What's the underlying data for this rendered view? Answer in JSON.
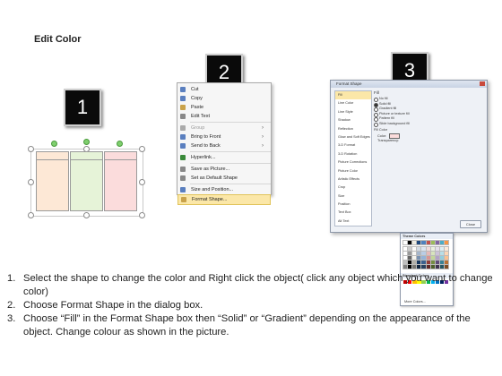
{
  "title": "Edit Color",
  "step_numbers": [
    "1",
    "2",
    "3"
  ],
  "shapes": {
    "card_colors": [
      "#fde8d6",
      "#e6f3d8",
      "#fbdcdc"
    ],
    "tab_colors": [
      "#fde8d6",
      "#e6f3d8",
      "#fbdcdc"
    ]
  },
  "context_menu": {
    "items": [
      {
        "label": "Cut",
        "icon": "scissors-icon",
        "icon_color": "#5a7fbf"
      },
      {
        "label": "Copy",
        "icon": "copy-icon",
        "icon_color": "#5a7fbf"
      },
      {
        "label": "Paste",
        "icon": "paste-icon",
        "icon_color": "#c9a24a"
      },
      {
        "label": "Edit Text",
        "icon": "text-icon",
        "icon_color": "#888888"
      },
      {
        "label": "Group",
        "icon": "group-icon",
        "icon_color": "#aaaaaa",
        "submenu": true,
        "disabled": true
      },
      {
        "label": "Bring to Front",
        "icon": "bring-front-icon",
        "icon_color": "#5a7fbf",
        "submenu": true
      },
      {
        "label": "Send to Back",
        "icon": "send-back-icon",
        "icon_color": "#5a7fbf",
        "submenu": true
      },
      {
        "label": "Hyperlink...",
        "icon": "hyperlink-icon",
        "icon_color": "#3a8a3a"
      },
      {
        "label": "Save as Picture...",
        "icon": "picture-icon",
        "icon_color": "#888888"
      },
      {
        "label": "Set as Default Shape",
        "icon": "default-shape-icon",
        "icon_color": "#888888"
      },
      {
        "label": "Size and Position...",
        "icon": "size-icon",
        "icon_color": "#5a7fbf"
      },
      {
        "label": "Format Shape...",
        "icon": "format-icon",
        "icon_color": "#c9a24a",
        "highlighted": true
      }
    ]
  },
  "dialog": {
    "title": "Format Shape",
    "categories": [
      "Fill",
      "Line Color",
      "Line Style",
      "Shadow",
      "Reflection",
      "Glow and Soft Edges",
      "3-D Format",
      "3-D Rotation",
      "Picture Corrections",
      "Picture Color",
      "Artistic Effects",
      "Crop",
      "Size",
      "Position",
      "Text Box",
      "Alt Text"
    ],
    "selected_category": "Fill",
    "fill_heading": "Fill",
    "fill_options": [
      "No fill",
      "Solid fill",
      "Gradient fill",
      "Picture or texture fill",
      "Pattern fill",
      "Slide background fill"
    ],
    "selected_fill_option": "Solid fill",
    "fill_color_heading": "Fill Color",
    "color_label": "Color:",
    "transparency_label": "Transparency:",
    "theme_colors_label": "Theme Colors",
    "standard_colors_label": "Standard Colors",
    "more_colors_label": "More Colors...",
    "close_label": "Close",
    "theme_color_columns": [
      "#ffffff",
      "#000000",
      "#eeece1",
      "#1f497d",
      "#4f81bd",
      "#c0504d",
      "#9bbb59",
      "#8064a2",
      "#4bacc6",
      "#f79646"
    ],
    "standard_colors": [
      "#c00000",
      "#ff0000",
      "#ffc000",
      "#ffff00",
      "#92d050",
      "#00b050",
      "#00b0f0",
      "#0070c0",
      "#002060",
      "#7030a0"
    ]
  },
  "instructions": [
    {
      "num": "1.",
      "text": "Select the shape to change the color and Right click the object( click any object which you want to change color)"
    },
    {
      "num": "2.",
      "text": "Choose Format Shape in the dialog box."
    },
    {
      "num": "3.",
      "text": "Choose “Fill” in the Format Shape box then “Solid” or “Gradient” depending on the appearance of the object. Change colour as shown in the picture."
    }
  ]
}
